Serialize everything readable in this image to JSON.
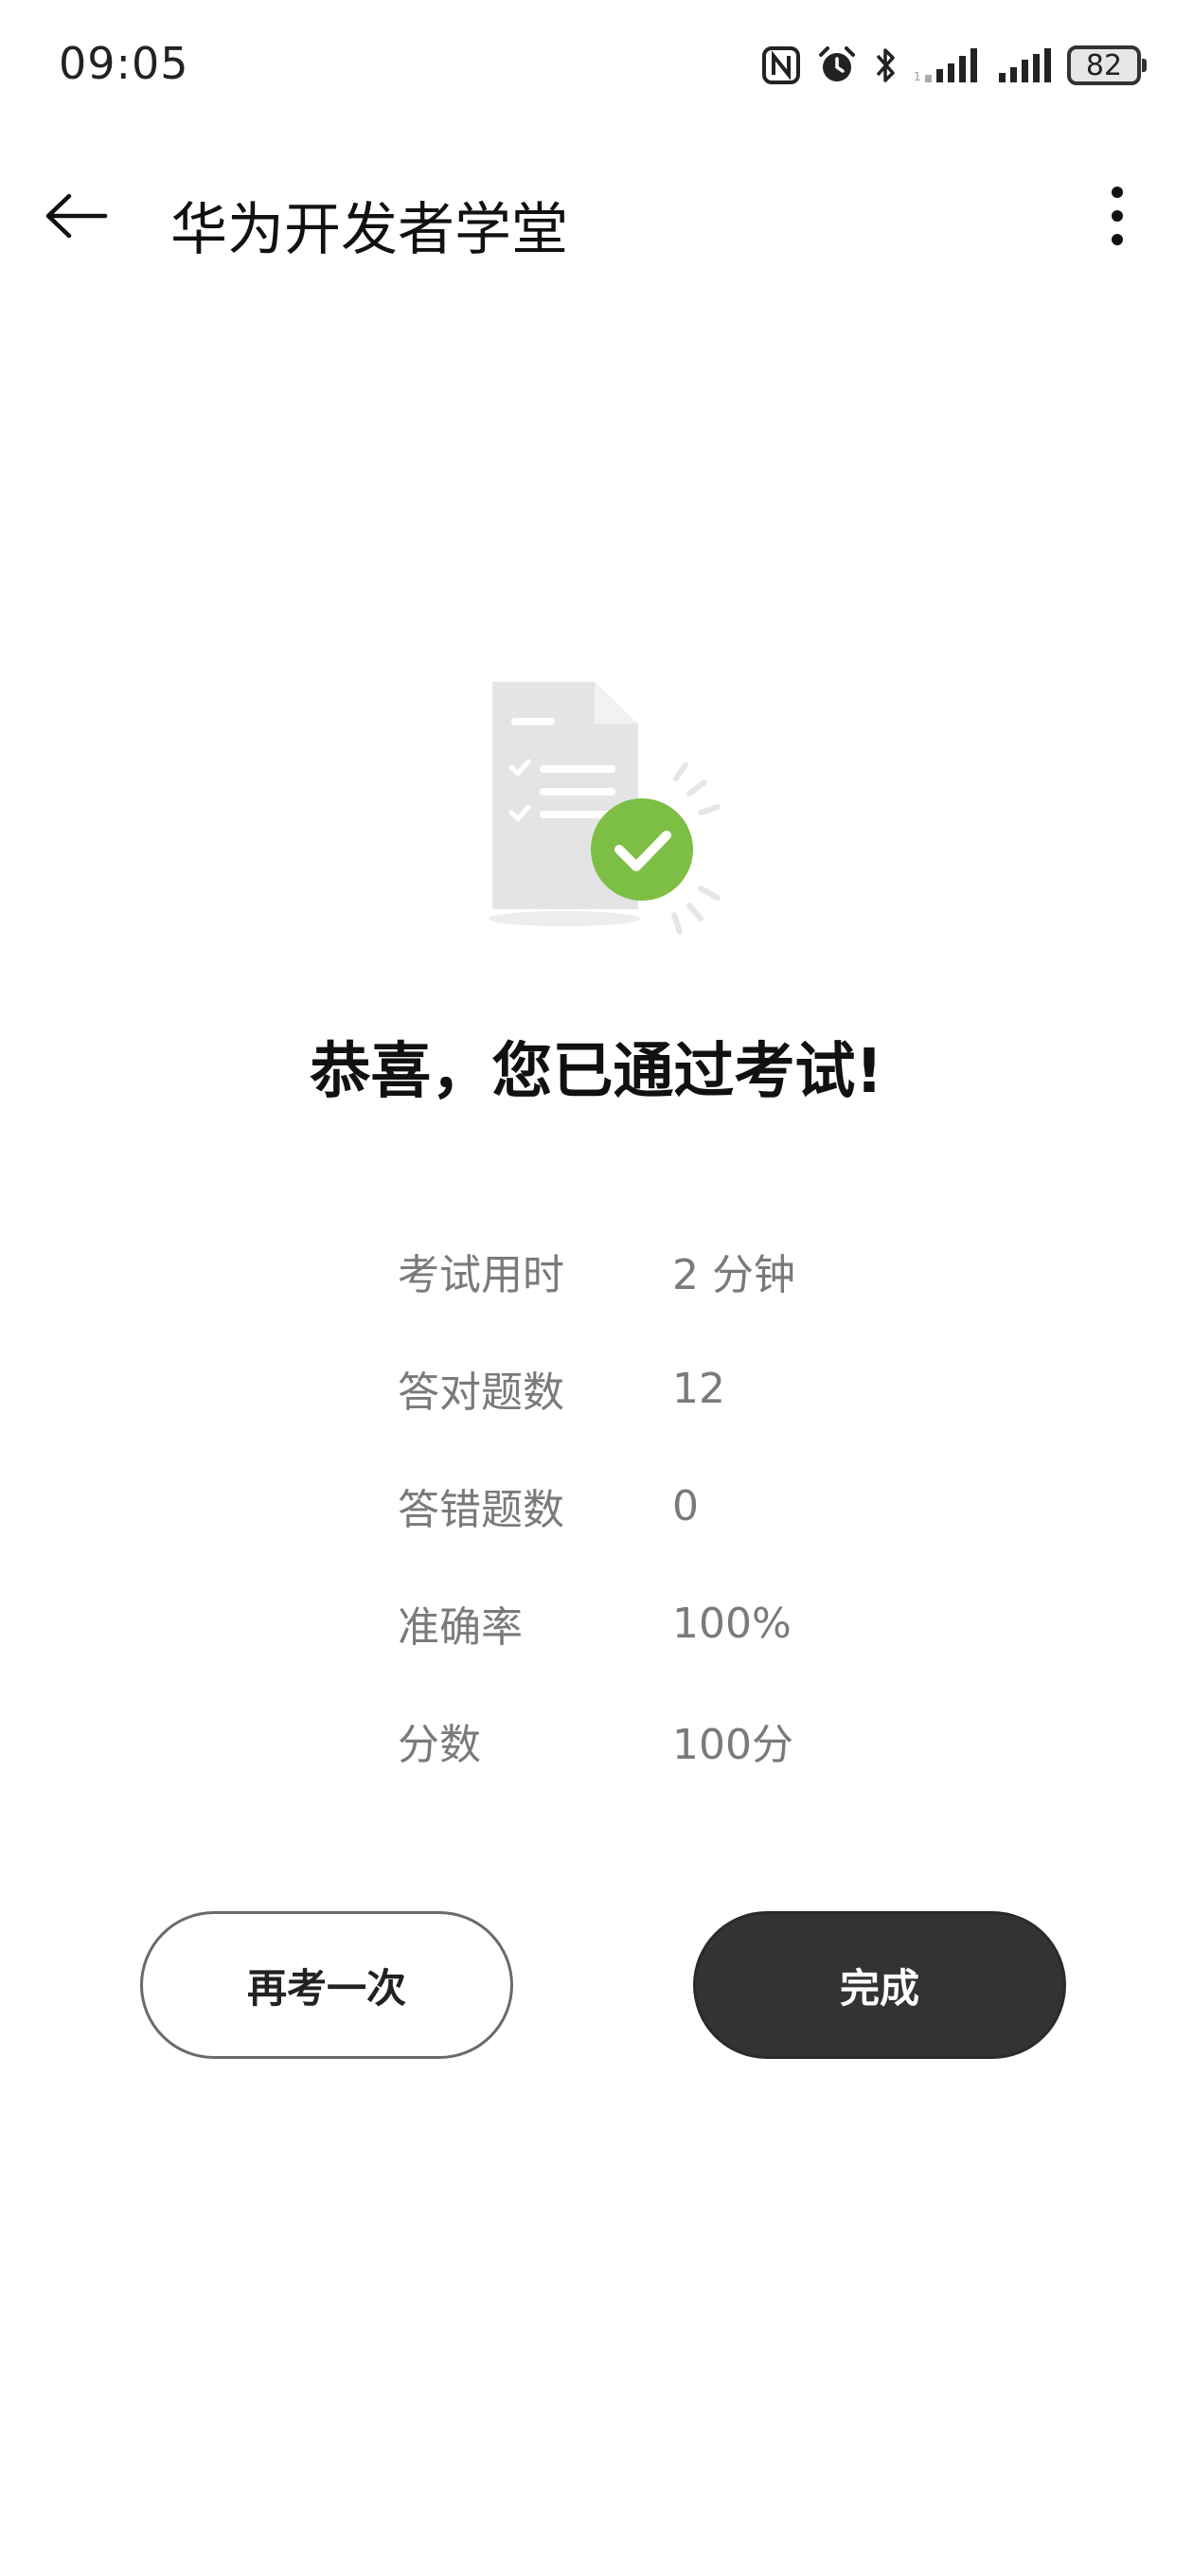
{
  "status_bar": {
    "time": "09:05",
    "battery": "82",
    "icons": [
      "nfc-icon",
      "alarm-icon",
      "bluetooth-icon",
      "signal-icon",
      "signal-icon"
    ]
  },
  "app_bar": {
    "title": "华为开发者学堂",
    "back_icon": "back-arrow-icon",
    "more_icon": "more-vert-icon"
  },
  "result": {
    "headline": "恭喜，您已通过考试!",
    "illustration_icon": "document-check-icon",
    "accent_color": "#7dbf45",
    "stats": [
      {
        "label": "考试用时",
        "value": "2 分钟"
      },
      {
        "label": "答对题数",
        "value": "12"
      },
      {
        "label": "答错题数",
        "value": "0"
      },
      {
        "label": "准确率",
        "value": "100%"
      },
      {
        "label": "分数",
        "value": "100分"
      }
    ]
  },
  "actions": {
    "retry_label": "再考一次",
    "done_label": "完成"
  }
}
